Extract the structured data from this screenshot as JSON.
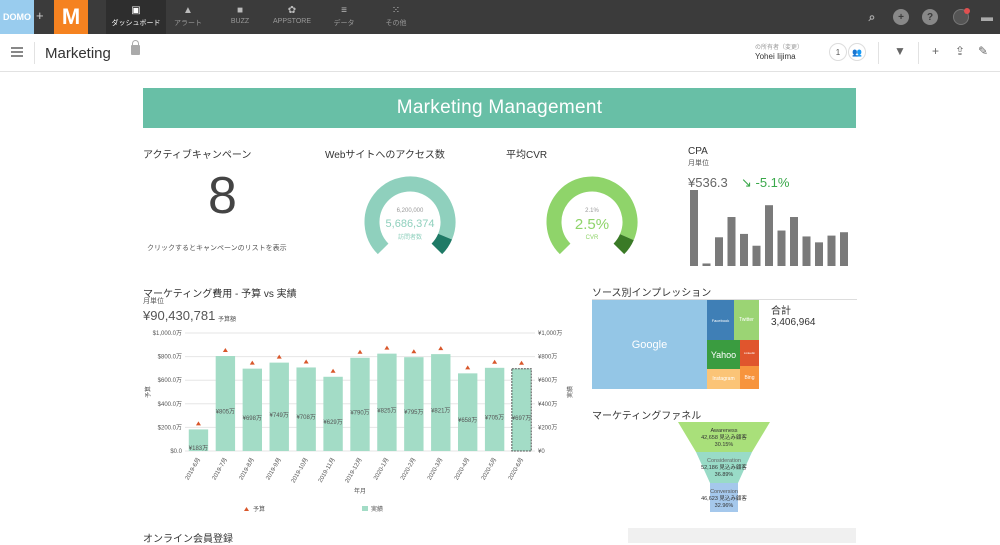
{
  "topbar": {
    "logo_text": "DOMO",
    "plus": "+",
    "app_logo": "M",
    "nav": [
      {
        "label": "ダッシュボード",
        "icon": "▣"
      },
      {
        "label": "アラート",
        "icon": "▲"
      },
      {
        "label": "BUZZ",
        "icon": "■"
      },
      {
        "label": "APPSTORE",
        "icon": "✿"
      },
      {
        "label": "データ",
        "icon": "≡"
      },
      {
        "label": "その他",
        "icon": "⁙"
      }
    ],
    "right_icons": [
      "search-icon",
      "plus-icon",
      "help-icon",
      "notifications-icon",
      "chat-icon"
    ]
  },
  "subbar": {
    "title": "Marketing",
    "owner_label": "の所有者（変更）",
    "owner_change": "変更",
    "owner_name": "Yohei Iijima",
    "share_count": "1"
  },
  "banner": {
    "title": "Marketing Management"
  },
  "kpis": {
    "campaigns": {
      "title": "アクティブキャンペーン",
      "value": "8",
      "note": "クリックするとキャンペーンのリストを表示"
    },
    "web": {
      "title": "Webサイトへのアクセス数",
      "target": "6,200,000",
      "value": "5,686,374",
      "label": "訪問者数",
      "fraction": 0.917
    },
    "cvr": {
      "title": "平均CVR",
      "target": "2.1%",
      "value": "2.5%",
      "label": "CVR",
      "fraction": 0.92
    },
    "cpa": {
      "title": "CPA",
      "subtitle": "月単位",
      "value": "¥536.3",
      "change": "-5.1%",
      "bars": [
        90,
        3,
        34,
        58,
        38,
        24,
        72,
        42,
        58,
        35,
        28,
        36,
        40
      ]
    }
  },
  "colors": {
    "accent": "#68bfa6",
    "bar": "#a3dcc6",
    "budget_marker": "#d9572b",
    "cvr_green": "#8fd46a",
    "cvr_dark": "#3a7a26",
    "web_teal": "#8fd0bd",
    "web_dark": "#1f7a66",
    "cpa_bar": "#7a7a7a",
    "up_green": "#3aa84a"
  },
  "budget": {
    "title": "マーケティング費用 - 予算 vs 実績",
    "subtitle": "月単位",
    "total": "¥90,430,781",
    "total_label": "予算額",
    "xlabel": "年月",
    "ylabel_left": "予算",
    "ylabel_right": "実績",
    "legend_budget": "予算",
    "legend_actual": "実績"
  },
  "impressions": {
    "title": "ソース別インプレッション",
    "total_label": "合計",
    "total": "3,406,964",
    "cells": [
      "Google",
      "Facebook",
      "Twitter",
      "Yahoo",
      "Linkedin",
      "Instagram",
      "Bing"
    ]
  },
  "funnel": {
    "title": "マーケティングファネル",
    "stages": [
      {
        "name": "Awareness",
        "count": "42,658 見込み顧客",
        "pct": "30.15%"
      },
      {
        "name": "Consideration",
        "count": "52,186 見込み顧客",
        "pct": "36.89%"
      },
      {
        "name": "Conversion",
        "count": "46,623 見込み顧客",
        "pct": "32.96%"
      }
    ]
  },
  "next_section": {
    "title": "オンライン会員登録"
  },
  "chart_data": [
    {
      "type": "bar",
      "title": "マーケティング費用 - 予算 vs 実績",
      "xlabel": "年月",
      "ylabel": "予算",
      "y2label": "実績",
      "categories": [
        "2019-6月",
        "2019-7月",
        "2019-8月",
        "2019-9月",
        "2019-10月",
        "2019-11月",
        "2019-12月",
        "2020-1月",
        "2020-2月",
        "2020-3月",
        "2020-4月",
        "2020-5月",
        "2020-6月"
      ],
      "series": [
        {
          "name": "実績",
          "values": [
            183,
            805,
            698,
            749,
            708,
            629,
            790,
            825,
            795,
            821,
            658,
            705,
            697
          ]
        },
        {
          "name": "予算",
          "values": [
            183,
            805,
            698,
            749,
            708,
            629,
            790,
            825,
            795,
            821,
            658,
            705,
            697
          ],
          "marker": "triangle"
        }
      ],
      "value_labels": [
        "¥183万",
        "¥805万",
        "¥698万",
        "¥749万",
        "¥708万",
        "¥629万",
        "¥790万",
        "¥825万",
        "¥795万",
        "¥821万",
        "¥658万",
        "¥705万",
        "¥697万"
      ],
      "ylim": [
        0,
        1000
      ],
      "yticks": [
        "$0.0",
        "$200.0万",
        "$400.0万",
        "$600.0万",
        "$800.0万",
        "$1,000.0万"
      ],
      "y2ticks": [
        "¥0",
        "¥200万",
        "¥400万",
        "¥600万",
        "¥800万",
        "¥1,000万"
      ],
      "legend": "bottom",
      "grid": true
    }
  ]
}
